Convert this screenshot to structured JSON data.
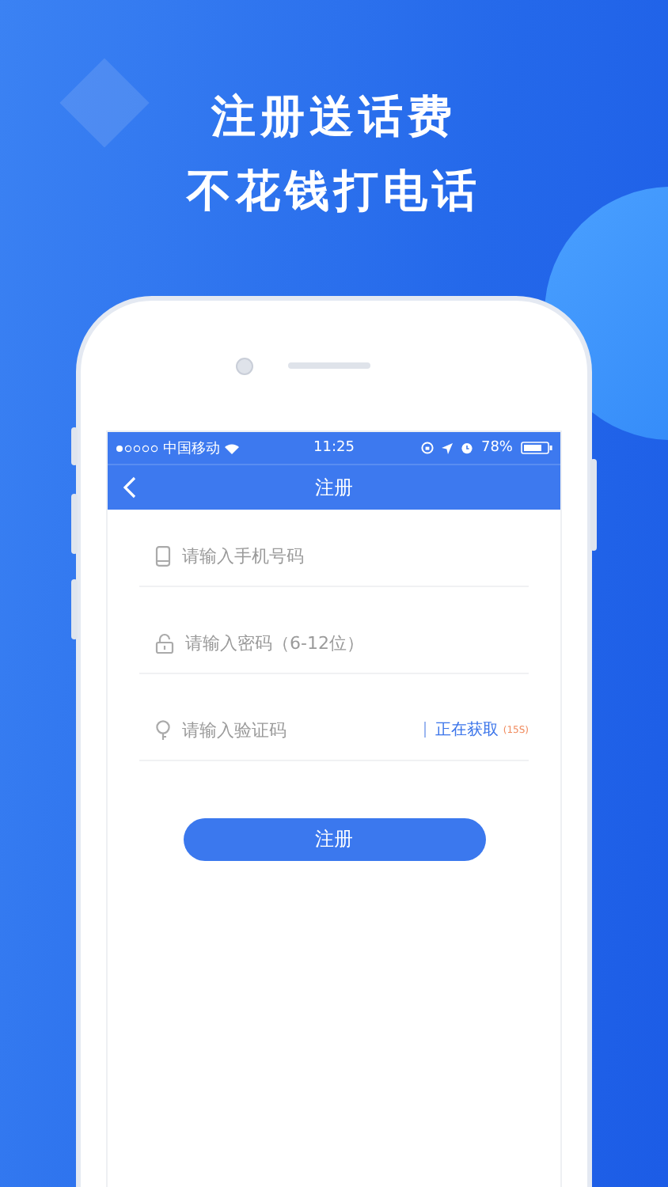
{
  "headline": [
    "注册送话费",
    "不花钱打电话"
  ],
  "status_bar": {
    "carrier": "中国移动",
    "time": "11:25",
    "battery": "78%"
  },
  "nav": {
    "title": "注册"
  },
  "fields": [
    {
      "kind": "phone",
      "placeholder": "请输入手机号码"
    },
    {
      "kind": "password",
      "placeholder": "请输入密码（6-12位）"
    },
    {
      "kind": "code",
      "placeholder": "请输入验证码",
      "action": "正在获取",
      "countdown": "(15S)"
    }
  ],
  "submit": "注册"
}
